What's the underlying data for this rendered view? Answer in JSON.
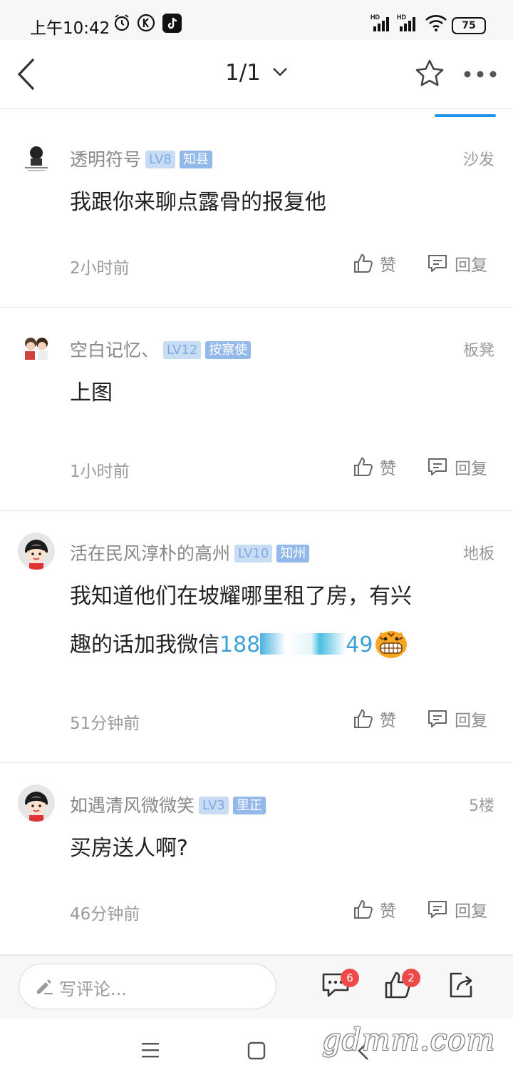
{
  "status": {
    "time": "上午10:42",
    "battery": "75",
    "signal_1": "HD",
    "signal_2": "HD"
  },
  "nav": {
    "title": "1/1"
  },
  "comments": [
    {
      "name": "透明符号",
      "level": "LV8",
      "title": "知县",
      "floor": "沙发",
      "text": "我跟你来聊点露骨的报复他",
      "time": "2小时前",
      "like_label": "赞",
      "reply_label": "回复"
    },
    {
      "name": "空白记忆、",
      "level": "LV12",
      "title": "按察使",
      "floor": "板凳",
      "text": "上图",
      "time": "1小时前",
      "like_label": "赞",
      "reply_label": "回复"
    },
    {
      "name": "活在民风淳朴的高州",
      "level": "LV10",
      "title": "知州",
      "floor": "地板",
      "text_line1": "我知道他们在坡耀哪里租了房，有兴",
      "text_line2_prefix": "趣的话加我微信",
      "text_num_start": "188",
      "text_num_end": "49",
      "time": "51分钟前",
      "like_label": "赞",
      "reply_label": "回复"
    },
    {
      "name": "如遇清风微微笑",
      "level": "LV3",
      "title": "里正",
      "floor": "5楼",
      "text": "买房送人啊?",
      "time": "46分钟前",
      "like_label": "赞",
      "reply_label": "回复"
    }
  ],
  "bottombar": {
    "placeholder": "写评论...",
    "comment_count": "6",
    "like_count": "2"
  },
  "watermark": "gdmm.com",
  "colors": {
    "accent": "#2196e8",
    "badge_level_bg": "#c8dcf4",
    "badge_title_bg": "#93b8ea",
    "notification_red": "#ef4a4a"
  }
}
